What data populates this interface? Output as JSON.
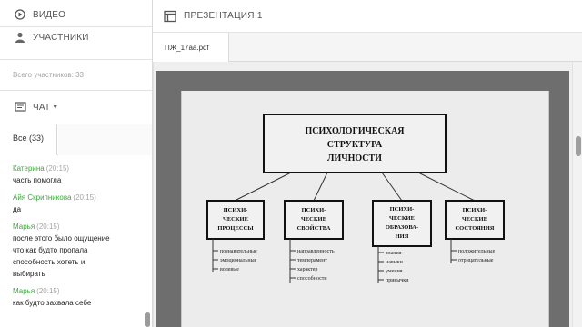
{
  "sidebar": {
    "video_label": "ВИДЕО",
    "users_label": "УЧАСТНИКИ",
    "total_text": "Всего участников: 33",
    "chat_label": "ЧАТ",
    "tab_all_label": "Все (33)",
    "messages": [
      {
        "name": "Катерина",
        "time": "(20:15)",
        "text": "часть помогла"
      },
      {
        "name": "Айя  Скрипникова",
        "time": "(20:15)",
        "text": "да"
      },
      {
        "name": "Марья",
        "time": "(20:15)",
        "text": "после этого было ощущение\nчто как будто пропала\nспособность хотеть и\nвыбирать"
      },
      {
        "name": "Марья",
        "time": "(20:15)",
        "text": "как будто захвала себе"
      }
    ]
  },
  "presentation": {
    "title": "ПРЕЗЕНТАЦИЯ 1",
    "file_tab": "ПЖ_17aa.pdf"
  },
  "diagram": {
    "root": [
      "ПСИХОЛОГИЧЕСКАЯ",
      "СТРУКТУРА",
      "ЛИЧНОСТИ"
    ],
    "boxes": [
      {
        "title": [
          "ПСИХИ-",
          "ЧЕСКИЕ",
          "ПРОЦЕССЫ"
        ],
        "items": [
          "познавательные",
          "эмоциональные",
          "волевые"
        ]
      },
      {
        "title": [
          "ПСИХИ-",
          "ЧЕСКИЕ",
          "СВОЙСТВА"
        ],
        "items": [
          "направленность",
          "темперамент",
          "характер",
          "способности"
        ]
      },
      {
        "title": [
          "ПСИХИ-",
          "ЧЕСКИЕ",
          "ОБРАЗОВА-",
          "НИЯ"
        ],
        "items": [
          "знания",
          "навыки",
          "умения",
          "привычки"
        ]
      },
      {
        "title": [
          "ПСИХИ-",
          "ЧЕСКИЕ",
          "СОСТОЯНИЯ"
        ],
        "items": [
          "положительные",
          "отрицательные"
        ]
      }
    ]
  },
  "colors": {
    "chat_name": "#3fa43f",
    "viewer_dark": "#6e6e6e",
    "page": "#ececec"
  }
}
